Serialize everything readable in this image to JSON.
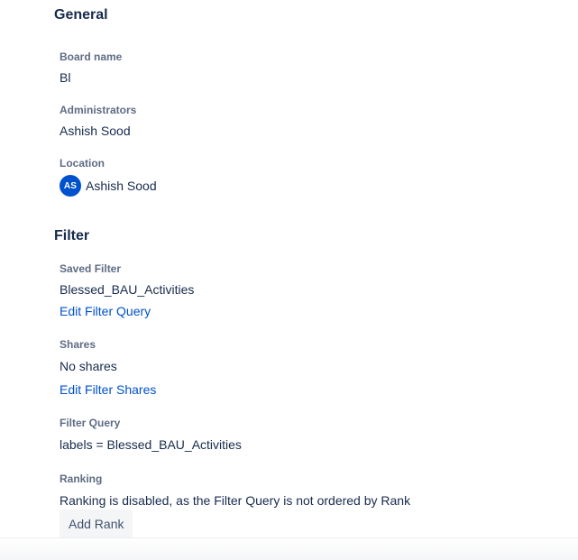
{
  "general": {
    "title": "General",
    "board_name": {
      "label": "Board name",
      "value": "Bl"
    },
    "administrators": {
      "label": "Administrators",
      "value": "Ashish Sood"
    },
    "location": {
      "label": "Location",
      "avatar_initials": "AS",
      "value": "Ashish Sood"
    }
  },
  "filter": {
    "title": "Filter",
    "saved_filter": {
      "label": "Saved Filter",
      "value": "Blessed_BAU_Activities",
      "link": "Edit Filter Query"
    },
    "shares": {
      "label": "Shares",
      "value": "No shares",
      "link": "Edit Filter Shares"
    },
    "filter_query": {
      "label": "Filter Query",
      "value": "labels = Blessed_BAU_Activities"
    },
    "ranking": {
      "label": "Ranking",
      "value": "Ranking is disabled, as the Filter Query is not ordered by Rank",
      "button": "Add Rank"
    }
  },
  "colors": {
    "link": "#0052cc",
    "label": "#5e6c84",
    "text": "#172b4d",
    "avatar_bg": "#0052cc",
    "button_bg": "#f4f5f7"
  }
}
